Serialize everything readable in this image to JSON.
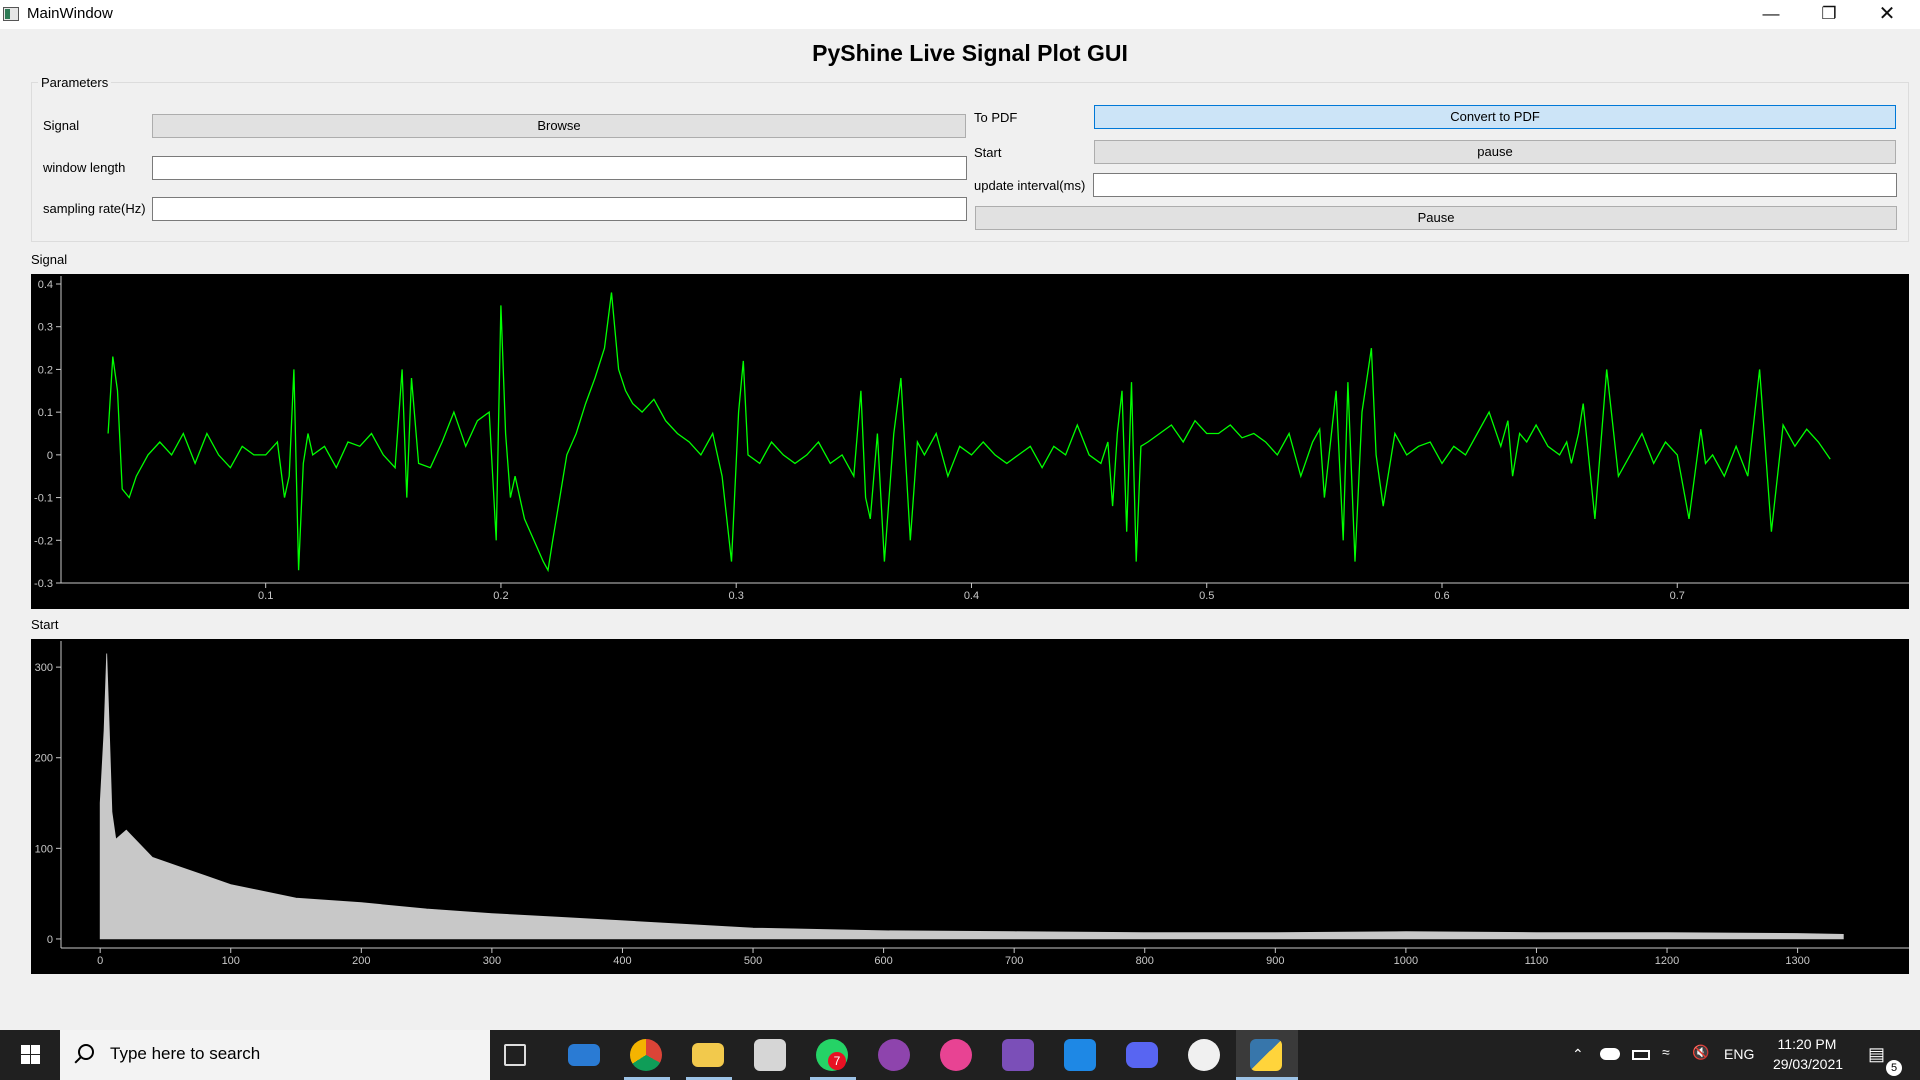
{
  "window": {
    "title": "MainWindow",
    "minimize_icon": "minimize-icon",
    "restore_icon": "restore-icon",
    "close_icon": "close-icon"
  },
  "header": {
    "title": "PyShine Live Signal Plot GUI"
  },
  "params": {
    "group_title": "Parameters",
    "signal_label": "Signal",
    "browse_label": "Browse",
    "window_length_label": "window length",
    "window_length_value": "",
    "sampling_rate_label": "sampling rate(Hz)",
    "sampling_rate_value": "",
    "to_pdf_label": "To PDF",
    "convert_label": "Convert to PDF",
    "start_label": "Start",
    "pause_small_label": "pause",
    "update_interval_label": "update interval(ms)",
    "update_interval_value": "",
    "pause_label": "Pause"
  },
  "plots": {
    "signal_label": "Signal",
    "spectrum_label": "Start"
  },
  "chart_data": [
    {
      "type": "line",
      "title": "",
      "xlabel": "",
      "ylabel": "",
      "xlim": [
        0.013,
        0.79
      ],
      "ylim": [
        -0.3,
        0.4
      ],
      "x_ticks": [
        0.1,
        0.2,
        0.3,
        0.4,
        0.5,
        0.6,
        0.7
      ],
      "y_ticks": [
        0.4,
        0.3,
        0.2,
        0.1,
        0,
        -0.1,
        -0.2,
        -0.3
      ],
      "grid": false,
      "color": "#00ff00",
      "x": [
        0.033,
        0.035,
        0.037,
        0.039,
        0.042,
        0.045,
        0.05,
        0.055,
        0.06,
        0.065,
        0.07,
        0.075,
        0.08,
        0.085,
        0.09,
        0.095,
        0.1,
        0.105,
        0.108,
        0.11,
        0.112,
        0.114,
        0.116,
        0.118,
        0.12,
        0.125,
        0.13,
        0.135,
        0.14,
        0.145,
        0.15,
        0.155,
        0.158,
        0.16,
        0.162,
        0.165,
        0.17,
        0.175,
        0.18,
        0.185,
        0.19,
        0.195,
        0.198,
        0.2,
        0.202,
        0.204,
        0.206,
        0.21,
        0.214,
        0.218,
        0.22,
        0.222,
        0.225,
        0.228,
        0.232,
        0.236,
        0.24,
        0.244,
        0.247,
        0.25,
        0.253,
        0.256,
        0.26,
        0.265,
        0.27,
        0.275,
        0.28,
        0.285,
        0.29,
        0.294,
        0.298,
        0.301,
        0.303,
        0.305,
        0.31,
        0.315,
        0.32,
        0.325,
        0.33,
        0.335,
        0.34,
        0.345,
        0.35,
        0.353,
        0.355,
        0.357,
        0.36,
        0.363,
        0.367,
        0.37,
        0.374,
        0.377,
        0.38,
        0.385,
        0.39,
        0.395,
        0.4,
        0.405,
        0.41,
        0.415,
        0.42,
        0.425,
        0.43,
        0.435,
        0.44,
        0.445,
        0.45,
        0.455,
        0.458,
        0.46,
        0.462,
        0.464,
        0.466,
        0.468,
        0.47,
        0.472,
        0.475,
        0.48,
        0.485,
        0.49,
        0.495,
        0.5,
        0.505,
        0.51,
        0.515,
        0.52,
        0.525,
        0.53,
        0.535,
        0.54,
        0.545,
        0.548,
        0.55,
        0.552,
        0.555,
        0.558,
        0.56,
        0.563,
        0.566,
        0.57,
        0.572,
        0.575,
        0.58,
        0.585,
        0.59,
        0.595,
        0.6,
        0.605,
        0.61,
        0.615,
        0.62,
        0.625,
        0.628,
        0.63,
        0.633,
        0.636,
        0.64,
        0.645,
        0.65,
        0.653,
        0.655,
        0.658,
        0.66,
        0.665,
        0.67,
        0.675,
        0.68,
        0.685,
        0.69,
        0.695,
        0.7,
        0.705,
        0.71,
        0.712,
        0.715,
        0.72,
        0.725,
        0.73,
        0.735,
        0.74,
        0.745,
        0.75,
        0.755,
        0.76,
        0.765,
        0.77,
        0.775
      ],
      "y": [
        0.05,
        0.23,
        0.15,
        -0.08,
        -0.1,
        -0.05,
        0.0,
        0.03,
        0.0,
        0.05,
        -0.02,
        0.05,
        0.0,
        -0.03,
        0.02,
        0.0,
        0.0,
        0.03,
        -0.1,
        -0.05,
        0.2,
        -0.27,
        -0.02,
        0.05,
        0.0,
        0.02,
        -0.03,
        0.03,
        0.02,
        0.05,
        0.0,
        -0.03,
        0.2,
        -0.1,
        0.18,
        -0.02,
        -0.03,
        0.03,
        0.1,
        0.02,
        0.08,
        0.1,
        -0.2,
        0.35,
        0.05,
        -0.1,
        -0.05,
        -0.15,
        -0.2,
        -0.25,
        -0.27,
        -0.2,
        -0.1,
        0.0,
        0.05,
        0.12,
        0.18,
        0.25,
        0.38,
        0.2,
        0.15,
        0.12,
        0.1,
        0.13,
        0.08,
        0.05,
        0.03,
        0.0,
        0.05,
        -0.05,
        -0.25,
        0.1,
        0.22,
        0.0,
        -0.02,
        0.03,
        0.0,
        -0.02,
        0.0,
        0.03,
        -0.02,
        0.0,
        -0.05,
        0.15,
        -0.1,
        -0.15,
        0.05,
        -0.25,
        0.05,
        0.18,
        -0.2,
        0.03,
        0.0,
        0.05,
        -0.05,
        0.02,
        0.0,
        0.03,
        0.0,
        -0.02,
        0.0,
        0.02,
        -0.03,
        0.02,
        0.0,
        0.07,
        0.0,
        -0.02,
        0.03,
        -0.12,
        0.05,
        0.15,
        -0.18,
        0.17,
        -0.25,
        0.02,
        0.03,
        0.05,
        0.07,
        0.03,
        0.08,
        0.05,
        0.05,
        0.07,
        0.04,
        0.05,
        0.03,
        0.0,
        0.05,
        -0.05,
        0.03,
        0.06,
        -0.1,
        0.0,
        0.15,
        -0.2,
        0.17,
        -0.25,
        0.1,
        0.25,
        0.0,
        -0.12,
        0.05,
        0.0,
        0.02,
        0.03,
        -0.02,
        0.02,
        0.0,
        0.05,
        0.1,
        0.02,
        0.08,
        -0.05,
        0.05,
        0.03,
        0.07,
        0.02,
        0.0,
        0.03,
        -0.02,
        0.05,
        0.12,
        -0.15,
        0.2,
        -0.05,
        0.0,
        0.05,
        -0.02,
        0.03,
        0.0,
        -0.15,
        0.06,
        -0.02,
        0.0,
        -0.05,
        0.02,
        -0.05,
        0.2,
        -0.18,
        0.07,
        0.02,
        0.06,
        0.03,
        -0.01
      ]
    },
    {
      "type": "area",
      "title": "",
      "xlabel": "",
      "ylabel": "",
      "xlim": [
        -30,
        1370
      ],
      "ylim": [
        -10,
        320
      ],
      "x_ticks": [
        0,
        100,
        200,
        300,
        400,
        500,
        600,
        700,
        800,
        900,
        1000,
        1100,
        1200,
        1300
      ],
      "y_ticks": [
        300,
        200,
        100,
        0
      ],
      "grid": false,
      "color": "#c8c8c8",
      "envelope_x": [
        0,
        3,
        5,
        7,
        9,
        12,
        20,
        40,
        60,
        80,
        100,
        150,
        200,
        250,
        300,
        350,
        400,
        500,
        600,
        700,
        800,
        900,
        1000,
        1100,
        1200,
        1300,
        1335
      ],
      "envelope_y": [
        150,
        230,
        315,
        230,
        140,
        110,
        120,
        90,
        80,
        70,
        60,
        45,
        40,
        33,
        28,
        24,
        20,
        12,
        9,
        8,
        7,
        7,
        8,
        7,
        7,
        6,
        5
      ]
    }
  ],
  "taskbar": {
    "start_icon": "windows-start-icon",
    "search_placeholder": "Type here to search",
    "apps": [
      "task-view-icon",
      "mail-icon",
      "chrome-icon",
      "file-explorer-icon",
      "microsoft-store-icon",
      "whatsapp-icon",
      "podcast-icon",
      "itunes-icon",
      "visual-studio-icon",
      "vscode-icon",
      "discord-icon",
      "github-icon",
      "python-icon"
    ],
    "whatsapp_badge": "7",
    "language": "ENG",
    "time": "11:20 PM",
    "date": "29/03/2021",
    "notification_count": "5"
  }
}
